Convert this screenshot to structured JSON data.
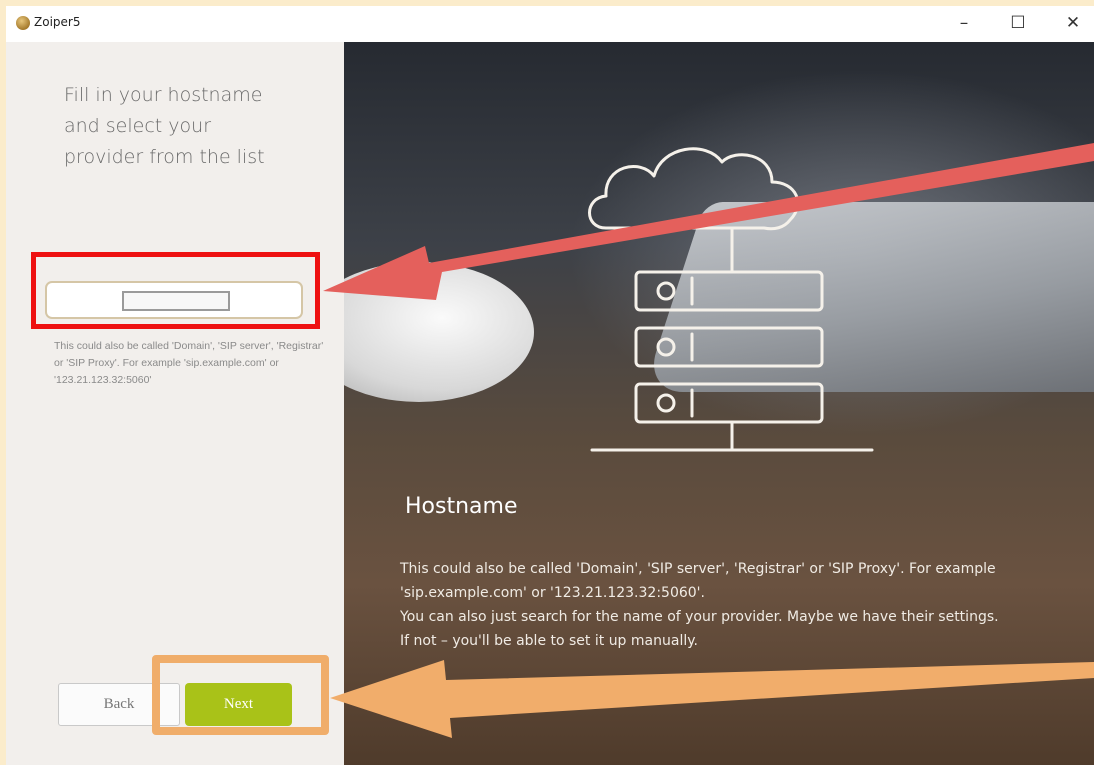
{
  "window": {
    "title": "Zoiper5",
    "controls": {
      "minimize": "–",
      "maximize": "☐",
      "close": "✕"
    }
  },
  "left_panel": {
    "heading": "Fill in your hostname\nand select your\nprovider from the list",
    "hostname_input": {
      "value": "",
      "placeholder": ""
    },
    "help_text": "This could also be called 'Domain', 'SIP server', 'Registrar' or 'SIP Proxy'. For example 'sip.example.com' or '123.21.123.32:5060'",
    "back_label": "Back",
    "next_label": "Next"
  },
  "right_panel": {
    "title": "Hostname",
    "description": "This could also be called 'Domain', 'SIP server', 'Registrar' or 'SIP Proxy'. For example 'sip.example.com' or '123.21.123.32:5060'.\nYou can also just search for the name of your provider. Maybe we have their settings. If not – you'll be able to set it up manually."
  },
  "colors": {
    "next_button": "#a9c218",
    "annotation_red": "#ee1111",
    "annotation_orange": "#f0ad6a",
    "arrow_red": "#e4605c",
    "arrow_orange": "#f1ad6b"
  }
}
